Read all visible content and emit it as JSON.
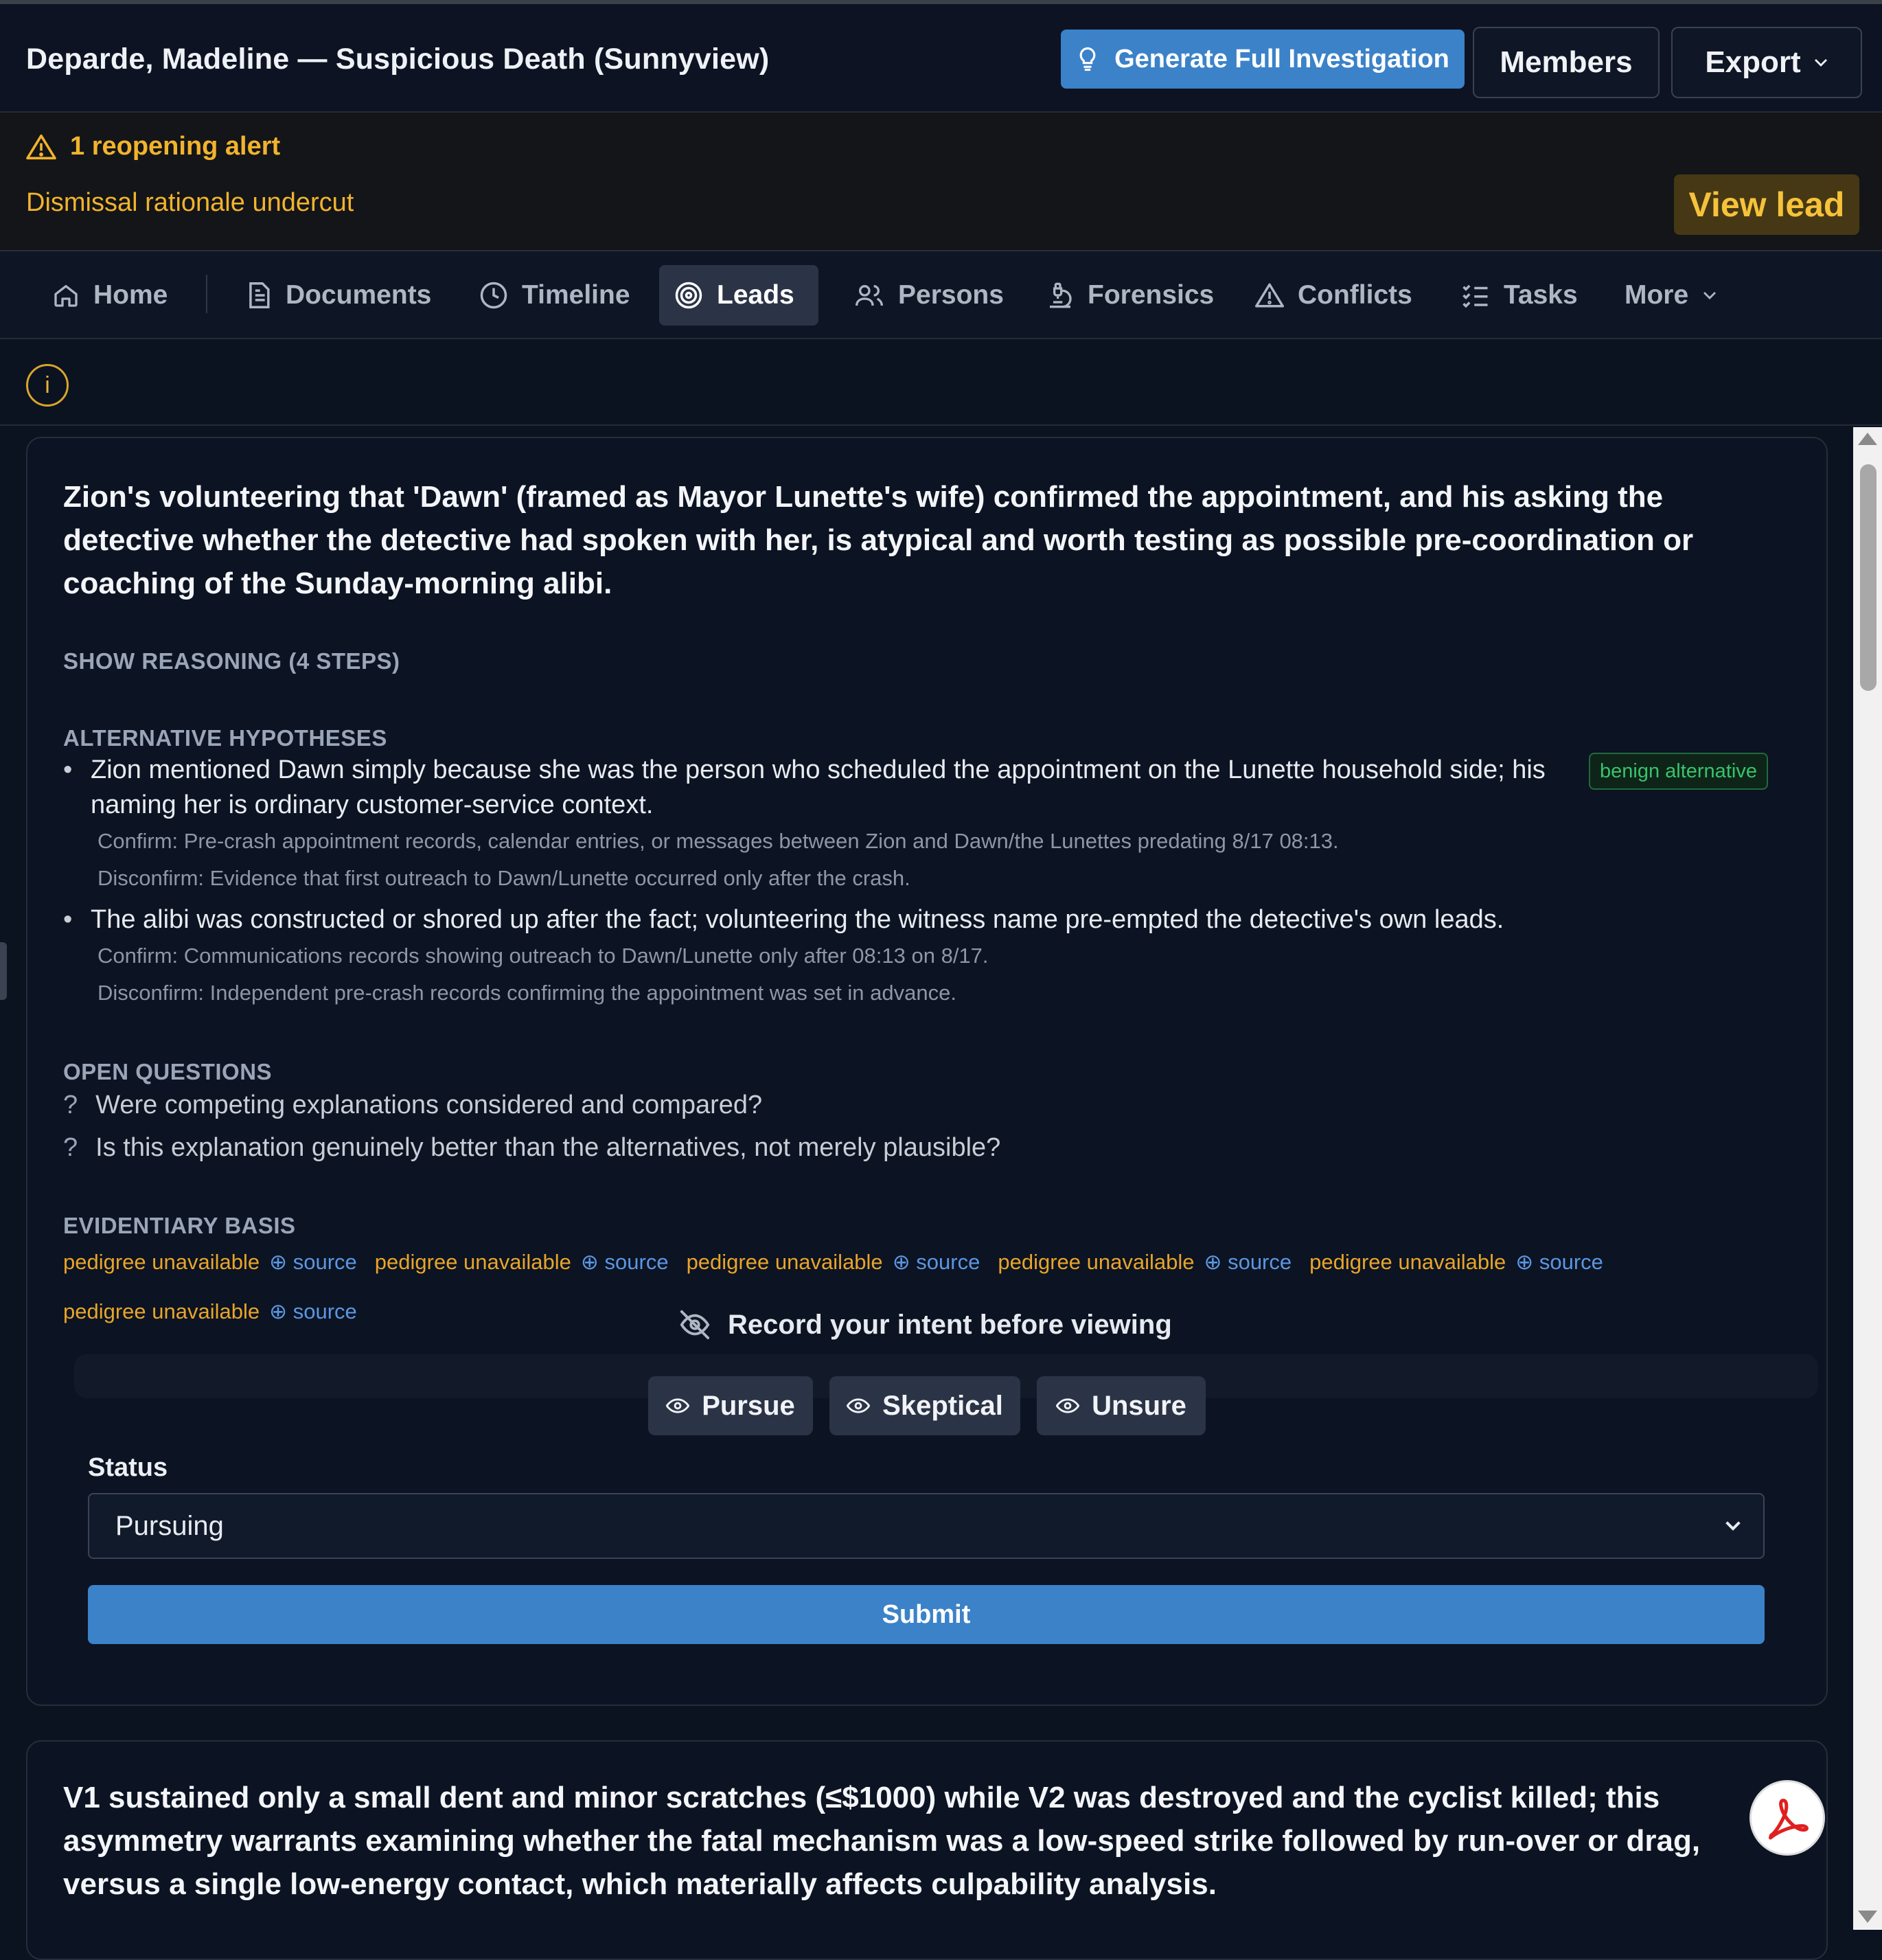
{
  "header": {
    "case_title": "Deparde, Madeline — Suspicious Death (Sunnyview)",
    "generate_label": "Generate Full Investigation",
    "members_label": "Members",
    "export_label": "Export"
  },
  "alert": {
    "title": "1 reopening alert",
    "subtitle": "Dismissal rationale undercut",
    "view_label": "View lead"
  },
  "tabs": [
    {
      "label": "Home",
      "icon": "home-icon"
    },
    {
      "label": "Documents",
      "icon": "document-icon"
    },
    {
      "label": "Timeline",
      "icon": "clock-icon"
    },
    {
      "label": "Leads",
      "icon": "target-icon",
      "active": true
    },
    {
      "label": "Persons",
      "icon": "users-icon"
    },
    {
      "label": "Forensics",
      "icon": "microscope-icon"
    },
    {
      "label": "Conflicts",
      "icon": "warning-icon"
    },
    {
      "label": "Tasks",
      "icon": "checklist-icon"
    },
    {
      "label": "More",
      "icon": "chevron-down-icon"
    }
  ],
  "info_glyph": "i",
  "lead": {
    "title": "Zion's volunteering that 'Dawn' (framed as Mayor Lunette's wife) confirmed the appointment, and his asking the detective whether the detective had spoken with her, is atypical and worth testing as possible pre-coordination or coaching of the Sunday-morning alibi.",
    "show_reasoning": "SHOW REASONING (4 STEPS)",
    "alt_label": "ALTERNATIVE HYPOTHESES",
    "hypotheses": [
      {
        "text": "Zion mentioned Dawn simply because she was the person who scheduled the appointment on the Lunette household side; his naming her is ordinary customer-service context.",
        "confirm": "Confirm: Pre-crash appointment records, calendar entries, or messages between Zion and Dawn/the Lunettes predating 8/17 08:13.",
        "disconfirm": "Disconfirm: Evidence that first outreach to Dawn/Lunette occurred only after the crash.",
        "badge": "benign alternative"
      },
      {
        "text": "The alibi was constructed or shored up after the fact; volunteering the witness name pre-empted the detective's own leads.",
        "confirm": "Confirm: Communications records showing outreach to Dawn/Lunette only after 08:13 on 8/17.",
        "disconfirm": "Disconfirm: Independent pre-crash records confirming the appointment was set in advance."
      }
    ],
    "open_label": "OPEN QUESTIONS",
    "questions": [
      "Were competing explanations considered and compared?",
      "Is this explanation genuinely better than the alternatives, not merely plausible?"
    ],
    "question_mark": "?",
    "evidence_label": "EVIDENTIARY BASIS",
    "evidence": [
      {
        "pedigree": "pedigree unavailable",
        "source": "source"
      },
      {
        "pedigree": "pedigree unavailable",
        "source": "source"
      },
      {
        "pedigree": "pedigree unavailable",
        "source": "source"
      },
      {
        "pedigree": "pedigree unavailable",
        "source": "source"
      },
      {
        "pedigree": "pedigree unavailable",
        "source": "source"
      },
      {
        "pedigree": "pedigree unavailable",
        "source": "source"
      }
    ],
    "intent_label": "Record your intent before viewing",
    "intent_buttons": [
      "Pursue",
      "Skeptical",
      "Unsure"
    ],
    "status_label": "Status",
    "status_value": "Pursuing",
    "submit_label": "Submit"
  },
  "lead2": {
    "title": "V1 sustained only a small dent and minor scratches (≤$1000) while V2 was destroyed and the cyclist killed; this asymmetry warrants examining whether the fatal mechanism was a low-speed strike followed by run-over or drag, versus a single low-energy contact, which materially affects culpability analysis."
  },
  "colors": {
    "accent": "#3b82c9",
    "alert": "#f2b32c",
    "badge_green": "#37c46b",
    "pedigree": "#e8a52a",
    "source_link": "#5a97e2"
  }
}
